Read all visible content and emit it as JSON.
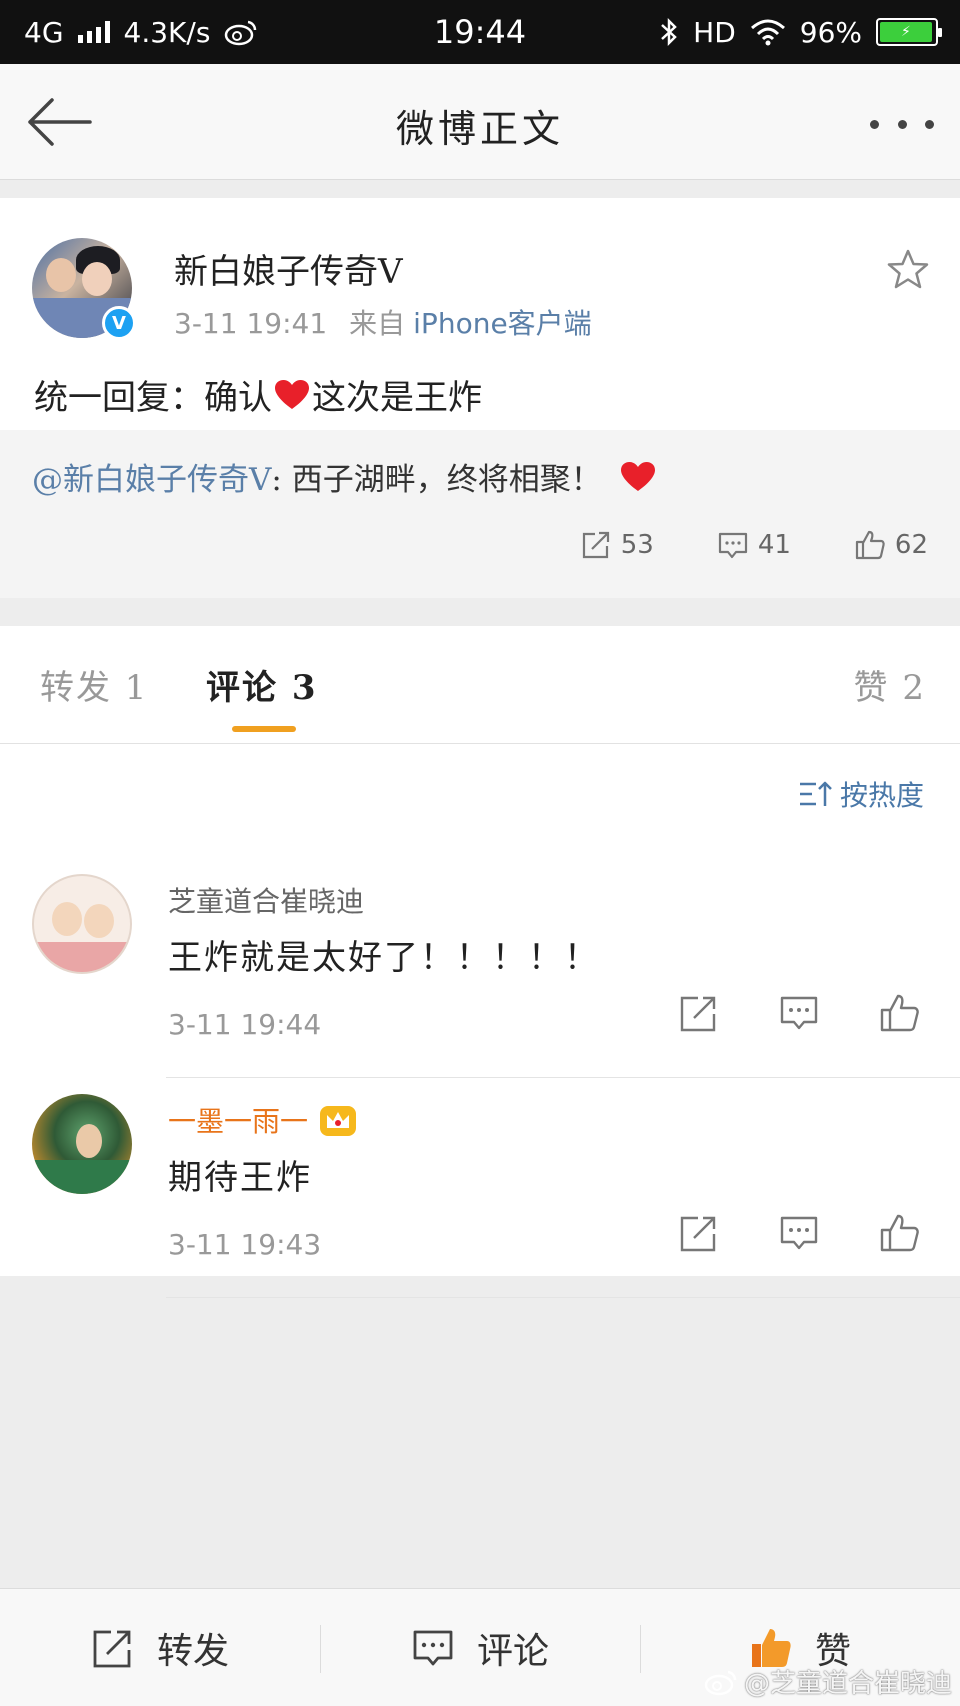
{
  "status_bar": {
    "network": "4G",
    "speed": "4.3K/s",
    "time": "19:44",
    "hd": "HD",
    "battery": "96%"
  },
  "nav": {
    "title": "微博正文"
  },
  "post": {
    "author": "新白娘子传奇V",
    "time": "3-11 19:41",
    "source_prefix": "来自",
    "source": "iPhone客户端",
    "text_before": "统一回复：确认",
    "text_after": "这次是王炸",
    "repost": {
      "mention": "@新白娘子传奇V",
      "text": ": 西子湖畔，终将相聚！",
      "stats": {
        "reposts": "53",
        "comments": "41",
        "likes": "62"
      }
    }
  },
  "tabs": {
    "repost": "转发 1",
    "comment": "评论 3",
    "like": "赞 2"
  },
  "sort_label": "按热度",
  "comments": [
    {
      "name": "芝童道合崔晓迪",
      "text": "王炸就是太好了！！！！！",
      "time": "3-11 19:44"
    },
    {
      "name": "一墨一雨一",
      "text": "期待王炸",
      "time": "3-11 19:43"
    }
  ],
  "bottom_bar": {
    "repost": "转发",
    "comment": "评论",
    "like": "赞"
  },
  "watermark": "@芝童道合崔晓迪",
  "colors": {
    "accent_orange": "#f0a020",
    "link_blue": "#5a7fa8",
    "heart_red": "#e8202a"
  }
}
